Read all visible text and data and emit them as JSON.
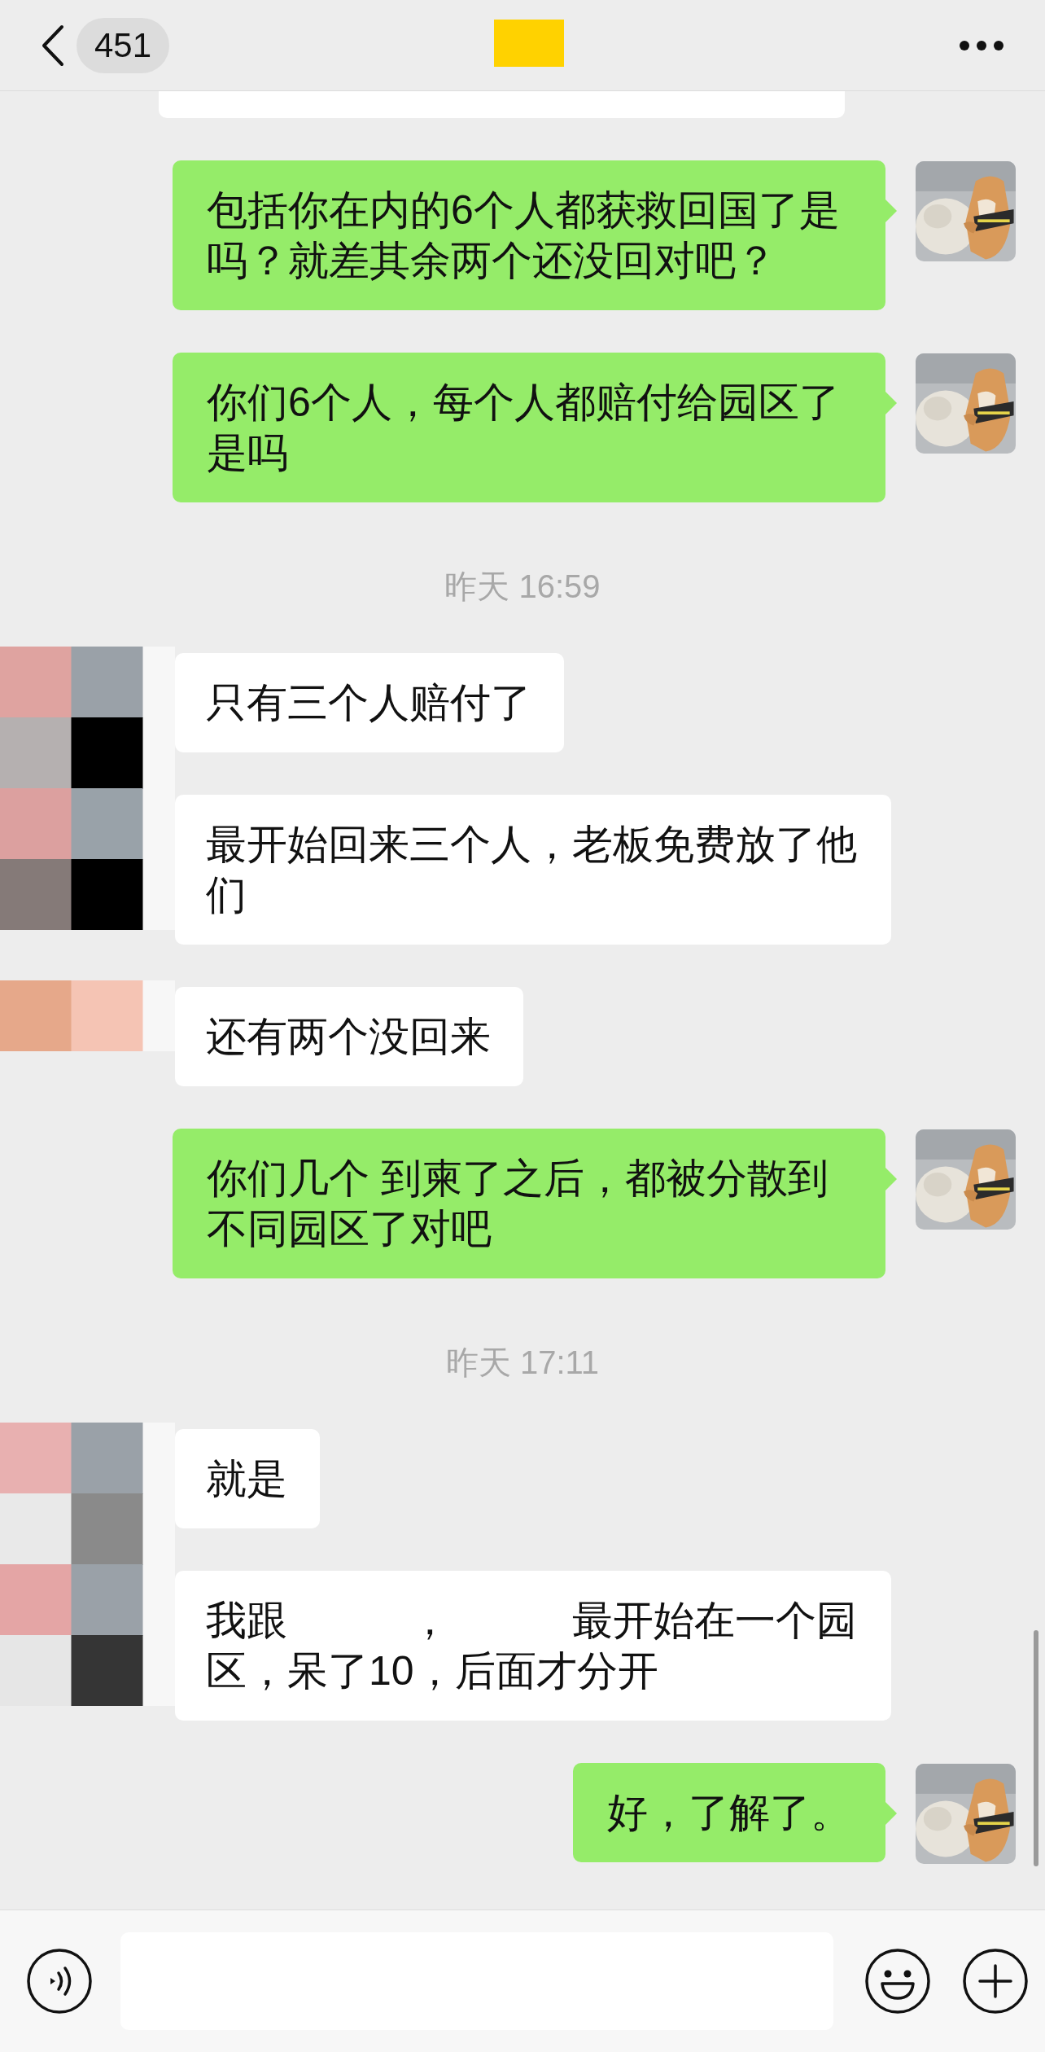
{
  "header": {
    "unread_count": "451"
  },
  "messages": [
    {
      "kind": "clipped"
    },
    {
      "kind": "outgoing",
      "text": "包括你在内的6个人都获救回国了是吗？就差其余两个还没回对吧？"
    },
    {
      "kind": "outgoing",
      "text": "你们6个人，每个人都赔付给园区了是吗"
    },
    {
      "kind": "time",
      "text": "昨天 16:59"
    },
    {
      "kind": "incoming",
      "text": "只有三个人赔付了"
    },
    {
      "kind": "incoming",
      "text": "最开始回来三个人，老板免费放了他们"
    },
    {
      "kind": "incoming",
      "text": "还有两个没回来"
    },
    {
      "kind": "outgoing",
      "text": "你们几个 到柬了之后，都被分散到不同园区了对吧"
    },
    {
      "kind": "time",
      "text": "昨天 17:11"
    },
    {
      "kind": "incoming",
      "text": "就是"
    },
    {
      "kind": "incoming",
      "text": "我跟　　　，　　　最开始在一个园区，呆了10，后面才分开"
    },
    {
      "kind": "outgoing",
      "text": "好，了解了。"
    }
  ]
}
